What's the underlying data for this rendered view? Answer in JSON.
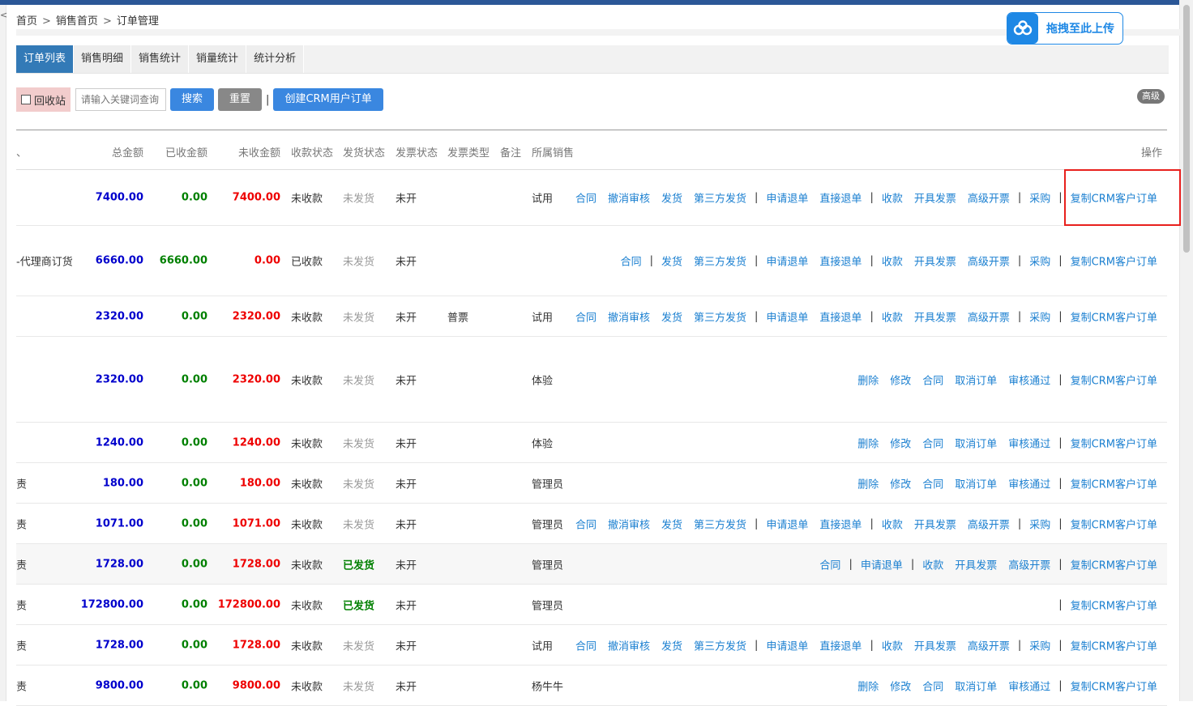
{
  "breadcrumb": {
    "items": [
      "首页",
      "销售首页",
      "订单管理"
    ],
    "separator": ">"
  },
  "upload": {
    "label": "拖拽至此上传",
    "icon": "cloud-icon",
    "color": "#1e88e5"
  },
  "tabs": [
    {
      "label": "订单列表",
      "active": true
    },
    {
      "label": "销售明细",
      "active": false
    },
    {
      "label": "销售统计",
      "active": false
    },
    {
      "label": "销量统计",
      "active": false
    },
    {
      "label": "统计分析",
      "active": false
    }
  ],
  "toolbar": {
    "recycle_label": "回收站",
    "recycle_checked": false,
    "search_placeholder": "请输入关键词查询",
    "search_label": "搜索",
    "reset_label": "重置",
    "pipe": "|",
    "create_label": "创建CRM用户订单",
    "advanced_label": "高级"
  },
  "columns": {
    "clipped": "、",
    "total": "总金额",
    "received": "已收金额",
    "unreceived": "未收金额",
    "pay_status": "收款状态",
    "ship_status": "发货状态",
    "invoice_status": "发票状态",
    "invoice_type": "发票类型",
    "remark": "备注",
    "sales": "所属销售",
    "ops": "操作"
  },
  "rows": [
    {
      "clipped": "",
      "total": "7400.00",
      "received": "0.00",
      "unreceived": "7400.00",
      "pay_status": "未收款",
      "ship_status": "未发货",
      "invoice_status": "未开",
      "invoice_type": "",
      "sales": "试用",
      "ops": [
        "合同",
        "撤消审核",
        "发货",
        "第三方发货",
        "|",
        "申请退单",
        "直接退单",
        "|",
        "收款",
        "开具发票",
        "高级开票",
        "|",
        "采购",
        "|",
        "复制CRM客户订单"
      ]
    },
    {
      "clipped": "-代理商订货",
      "total": "6660.00",
      "received": "6660.00",
      "unreceived": "0.00",
      "pay_status": "已收款",
      "ship_status": "未发货",
      "invoice_status": "未开",
      "invoice_type": "",
      "sales": "",
      "ops": [
        "合同",
        "|",
        "发货",
        "第三方发货",
        "|",
        "申请退单",
        "直接退单",
        "|",
        "收款",
        "开具发票",
        "高级开票",
        "|",
        "采购",
        "|",
        "复制CRM客户订单"
      ]
    },
    {
      "clipped": "",
      "total": "2320.00",
      "received": "0.00",
      "unreceived": "2320.00",
      "pay_status": "未收款",
      "ship_status": "未发货",
      "invoice_status": "未开",
      "invoice_type": "普票",
      "sales": "试用",
      "ops": [
        "合同",
        "撤消审核",
        "发货",
        "第三方发货",
        "|",
        "申请退单",
        "直接退单",
        "|",
        "收款",
        "开具发票",
        "高级开票",
        "|",
        "采购",
        "|",
        "复制CRM客户订单"
      ]
    },
    {
      "clipped": "",
      "total": "2320.00",
      "received": "0.00",
      "unreceived": "2320.00",
      "pay_status": "未收款",
      "ship_status": "未发货",
      "invoice_status": "未开",
      "invoice_type": "",
      "sales": "体验",
      "ops": [
        "删除",
        "修改",
        "合同",
        "取消订单",
        "审核通过",
        "|",
        "复制CRM客户订单"
      ]
    },
    {
      "clipped": "",
      "total": "1240.00",
      "received": "0.00",
      "unreceived": "1240.00",
      "pay_status": "未收款",
      "ship_status": "未发货",
      "invoice_status": "未开",
      "invoice_type": "",
      "sales": "体验",
      "ops": [
        "删除",
        "修改",
        "合同",
        "取消订单",
        "审核通过",
        "|",
        "复制CRM客户订单"
      ]
    },
    {
      "clipped": "责",
      "total": "180.00",
      "received": "0.00",
      "unreceived": "180.00",
      "pay_status": "未收款",
      "ship_status": "未发货",
      "invoice_status": "未开",
      "invoice_type": "",
      "sales": "管理员",
      "ops": [
        "删除",
        "修改",
        "合同",
        "取消订单",
        "审核通过",
        "|",
        "复制CRM客户订单"
      ]
    },
    {
      "clipped": "责",
      "total": "1071.00",
      "received": "0.00",
      "unreceived": "1071.00",
      "pay_status": "未收款",
      "ship_status": "未发货",
      "invoice_status": "未开",
      "invoice_type": "",
      "sales": "管理员",
      "ops": [
        "合同",
        "撤消审核",
        "发货",
        "第三方发货",
        "|",
        "申请退单",
        "直接退单",
        "|",
        "收款",
        "开具发票",
        "高级开票",
        "|",
        "采购",
        "|",
        "复制CRM客户订单"
      ]
    },
    {
      "clipped": "责",
      "total": "1728.00",
      "received": "0.00",
      "unreceived": "1728.00",
      "pay_status": "未收款",
      "ship_status": "已发货",
      "invoice_status": "未开",
      "invoice_type": "",
      "sales": "管理员",
      "ops": [
        "合同",
        "|",
        "申请退单",
        "|",
        "收款",
        "开具发票",
        "高级开票",
        "|",
        "复制CRM客户订单"
      ]
    },
    {
      "clipped": "责",
      "total": "172800.00",
      "received": "0.00",
      "unreceived": "172800.00",
      "pay_status": "未收款",
      "ship_status": "已发货",
      "invoice_status": "未开",
      "invoice_type": "",
      "sales": "管理员",
      "ops": [
        "|",
        "复制CRM客户订单"
      ]
    },
    {
      "clipped": "责",
      "total": "1728.00",
      "received": "0.00",
      "unreceived": "1728.00",
      "pay_status": "未收款",
      "ship_status": "未发货",
      "invoice_status": "未开",
      "invoice_type": "",
      "sales": "试用",
      "ops": [
        "合同",
        "撤消审核",
        "发货",
        "第三方发货",
        "|",
        "申请退单",
        "直接退单",
        "|",
        "收款",
        "开具发票",
        "高级开票",
        "|",
        "采购",
        "|",
        "复制CRM客户订单"
      ]
    },
    {
      "clipped": "责",
      "total": "9800.00",
      "received": "0.00",
      "unreceived": "9800.00",
      "pay_status": "未收款",
      "ship_status": "未发货",
      "invoice_status": "未开",
      "invoice_type": "",
      "sales": "杨牛牛",
      "ops": [
        "删除",
        "修改",
        "合同",
        "取消订单",
        "审核通过",
        "|",
        "复制CRM客户订单"
      ]
    }
  ],
  "colors": {
    "accent": "#337ab7",
    "link": "#1a7fd0",
    "total": "#0000cc",
    "received": "#008000",
    "unreceived": "#ee0000",
    "highlight": "#e8201d"
  }
}
